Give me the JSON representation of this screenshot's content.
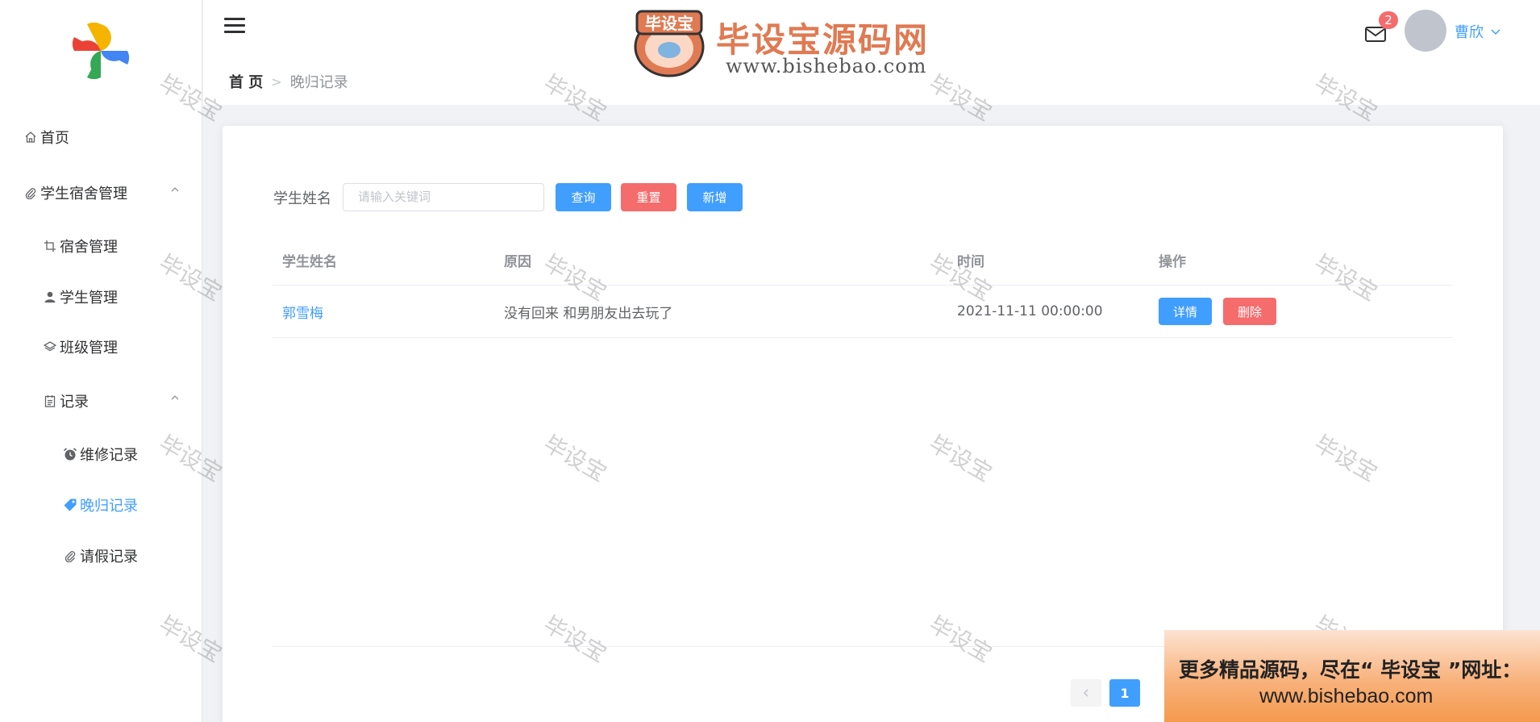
{
  "sidebar": {
    "logo_icon": "pinwheel-logo-icon",
    "items": [
      {
        "label": "首页",
        "icon": "home-icon"
      },
      {
        "label": "学生宿舍管理",
        "icon": "paperclip-icon"
      },
      {
        "label": "宿舍管理",
        "icon": "crop-icon"
      },
      {
        "label": "学生管理",
        "icon": "user-icon"
      },
      {
        "label": "班级管理",
        "icon": "layers-icon"
      },
      {
        "label": "记录",
        "icon": "document-icon"
      },
      {
        "label": "维修记录",
        "icon": "alarm-clock-icon"
      },
      {
        "label": "晚归记录",
        "icon": "price-tag-icon"
      },
      {
        "label": "请假记录",
        "icon": "paperclip-icon"
      }
    ],
    "active_item": "晚归记录"
  },
  "header": {
    "breadcrumb": {
      "home": "首 页",
      "current": "晚归记录"
    },
    "mail_badge": "2",
    "username": "曹欣"
  },
  "site_watermark": {
    "logo_text": "毕设宝",
    "title": "毕设宝源码网",
    "url": "www.bishebao.com",
    "overlay_text": "毕设宝"
  },
  "search": {
    "label": "学生姓名",
    "placeholder": "请输入关键词",
    "value": "",
    "query_btn": "查询",
    "reset_btn": "重置",
    "add_btn": "新增"
  },
  "table": {
    "columns": [
      "学生姓名",
      "原因",
      "时间",
      "操作"
    ],
    "rows": [
      {
        "name": "郭雪梅",
        "reason": "没有回来 和男朋友出去玩了",
        "time": "2021-11-11 00:00:00",
        "detail_btn": "详情",
        "delete_btn": "删除"
      }
    ]
  },
  "pagination": {
    "current_page": "1"
  },
  "banner": {
    "line1": "更多精品源码，尽在“ 毕设宝 ”网址：",
    "line2": "www.bishebao.com"
  },
  "colors": {
    "primary": "#409eff",
    "danger": "#f56c6c",
    "watermark_orange": "#e07a52"
  }
}
